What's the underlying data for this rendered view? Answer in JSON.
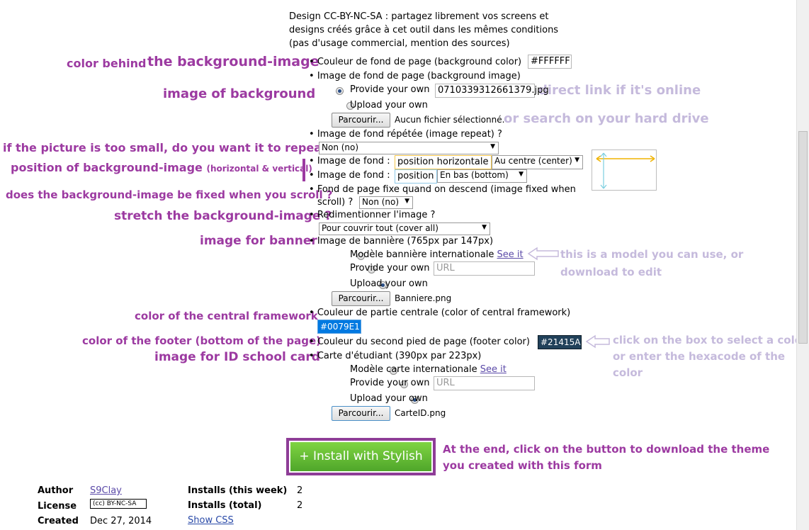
{
  "intro": {
    "line1": "Design CC-BY-NC-SA : partagez librement vos screens et",
    "line2": "designs créés grâce à cet outil dans les mêmes conditions",
    "line3": "(pas d'usage commercial, mention des sources)"
  },
  "annotations": {
    "color_behind": "color behind",
    "the_bg_image": "the background-image",
    "image_of_bg": "image of background",
    "direct_link": "direct link if it's online",
    "search_hd": "or search on your hard drive",
    "repeat_q": "if the picture is too small, do you want it to repeat ?",
    "position_bg": "position of background-image",
    "position_sub": "(horizontal & vertical)",
    "fixed_q": "does the background-image be fixed when you scroll ?",
    "stretch_q": "stretch the background-image ?",
    "image_banner": "image for banner",
    "model_note_1": "this is a model you can use, or",
    "model_note_2": "download to edit",
    "central_color": "color of the central framework",
    "footer_color": "color of the footer (bottom of the page)",
    "id_card": "image for  ID school card",
    "click_box_1": "click on the box to select a color,",
    "click_box_2": "or enter the hexacode of the",
    "click_box_3": "color",
    "at_end_1": "At the end, click on the button to download the theme",
    "at_end_2": "you created with this form"
  },
  "form": {
    "bg_color_label": "Couleur de fond de page (background color)",
    "bg_color_value": "#FFFFFF",
    "bg_image_label": "Image de fond de page (background image)",
    "provide_own": "Provide your own",
    "bg_image_value": "0710339312661379.jpg",
    "upload_own": "Upload your own",
    "browse": "Parcourir...",
    "no_file": "Aucun fichier sélectionné.",
    "repeat_label": "Image de fond répétée (image repeat) ?",
    "repeat_value": "Non (no)",
    "pos_label": "Image de fond :",
    "pos_h_text": "position horizontale",
    "pos_h_value": "Au centre (center)",
    "pos_v_text": "position",
    "pos_v_value": "En bas (bottom)",
    "fixed_label_1": "Fond de page fixe quand on descend (image fixed when",
    "fixed_label_2": "scroll) ?",
    "fixed_value": "Non (no)",
    "resize_label": "Redimentionner l'image ?",
    "resize_value": "Pour couvrir tout (cover all)",
    "banner_label": "Image de bannière (765px par 147px)",
    "banner_model": "Modèle bannière internationale",
    "see_it": "See it",
    "url_placeholder": "URL",
    "banner_file": "Banniere.png",
    "central_label": "Couleur de partie centrale (color of central framework)",
    "central_value": "#0079E1",
    "footer_label": "Couleur du second pied de page (footer color)",
    "footer_value": "#21415A",
    "card_label": "Carte d'étudiant (390px par 223px)",
    "card_model": "Modèle carte internationale",
    "card_file": "CarteID.png"
  },
  "install": {
    "label": "+ Install with Stylish"
  },
  "meta": {
    "author_label": "Author",
    "author_value": "S9Clay",
    "license_label": "License",
    "license_badge": "(cc) BY-NC-SA",
    "created_label": "Created",
    "created_value": "Dec 27, 2014",
    "week_label": "Installs (this week)",
    "week_value": "2",
    "total_label": "Installs (total)",
    "total_value": "2",
    "show_css": "Show CSS"
  },
  "colors": {
    "annotation": "#9c3aa1",
    "annotation_light": "#c5badc",
    "central": "#0079E1",
    "footer": "#21415A",
    "install_green": "#6cc63a"
  }
}
